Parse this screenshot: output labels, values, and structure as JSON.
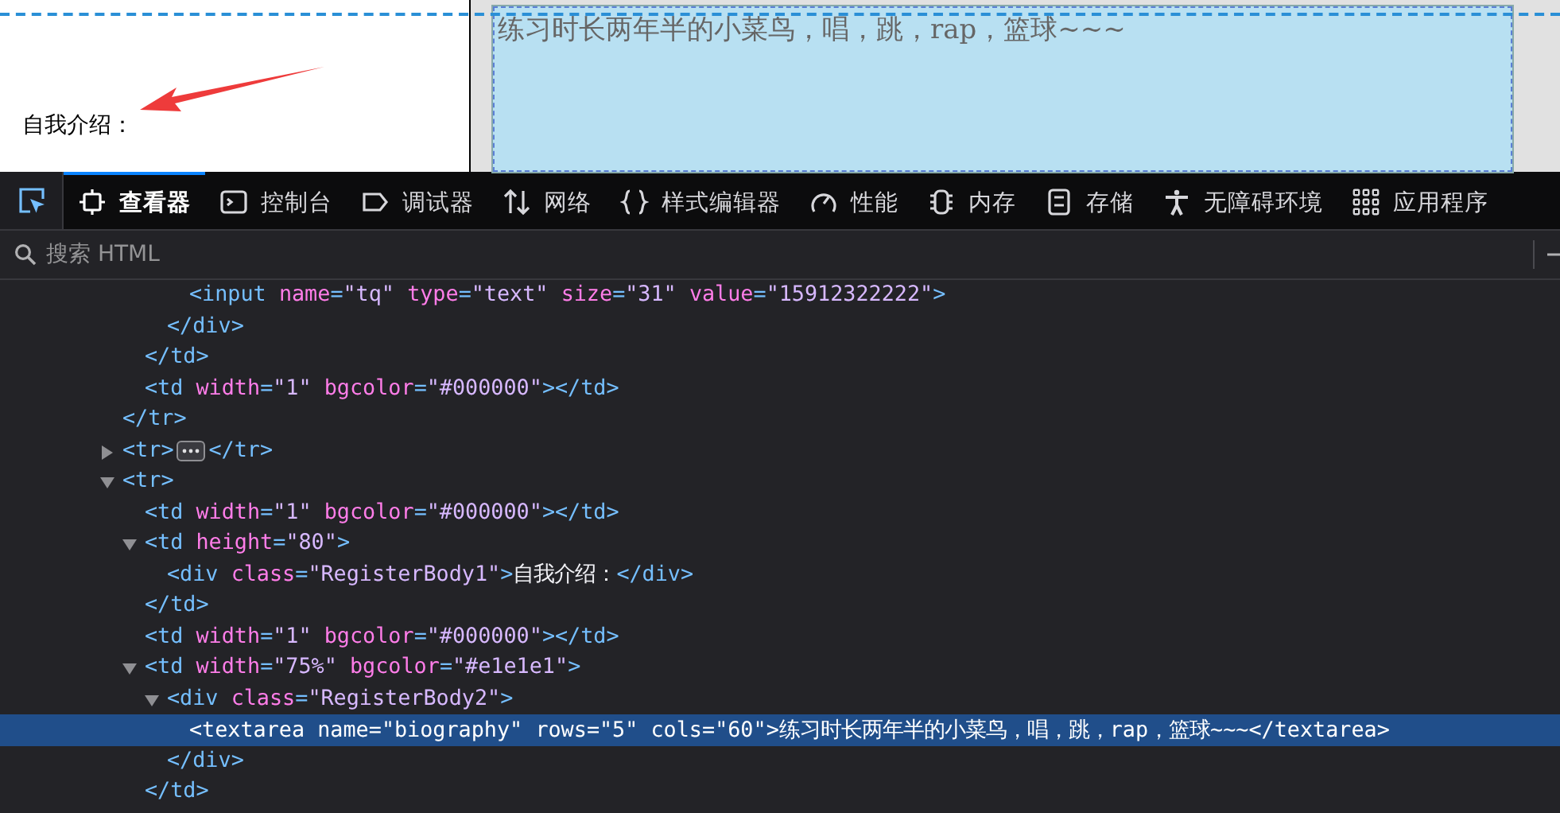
{
  "page": {
    "label": "自我介绍：",
    "textarea_value": "练习时长两年半的小菜鸟，唱，跳，rap，篮球~~~"
  },
  "devtools": {
    "picker_selected": true,
    "tabs": [
      {
        "label": "查看器",
        "selected": true
      },
      {
        "label": "控制台",
        "selected": false
      },
      {
        "label": "调试器",
        "selected": false
      },
      {
        "label": "网络",
        "selected": false
      },
      {
        "label": "样式编辑器",
        "selected": false
      },
      {
        "label": "性能",
        "selected": false
      },
      {
        "label": "内存",
        "selected": false
      },
      {
        "label": "存储",
        "selected": false
      },
      {
        "label": "无障碍环境",
        "selected": false
      },
      {
        "label": "应用程序",
        "selected": false
      }
    ],
    "search": {
      "placeholder": "搜索 HTML"
    },
    "tree": [
      {
        "close": "</tr>",
        "children": [
          {
            "close": "</td>",
            "children": [
              {
                "close": "</div>",
                "children": [
                  {
                    "open": "<input name=\"tq\" type=\"text\" size=\"31\" value=\"15912322222\">",
                    "selected": false
                  }
                ]
              }
            ]
          },
          {
            "open": "<td width=\"1\" bgcolor=\"#000000\"></td>",
            "selected": false
          }
        ]
      },
      {
        "open": "<tr>",
        "close": "</tr>",
        "expanded": false,
        "selected": false
      },
      {
        "open": "<tr>",
        "expanded": true,
        "selected": false,
        "children": [
          {
            "open": "<td width=\"1\" bgcolor=\"#000000\"></td>",
            "selected": false
          },
          {
            "open": "<td height=\"80\">",
            "close": "</td>",
            "expanded": true,
            "selected": false,
            "children": [
              {
                "open": "<div class=\"RegisterBody1\">自我介绍：</div>",
                "selected": false
              }
            ]
          },
          {
            "open": "<td width=\"1\" bgcolor=\"#000000\"></td>",
            "selected": false
          },
          {
            "open": "<td width=\"75%\" bgcolor=\"#e1e1e1\">",
            "close": "</td>",
            "expanded": true,
            "selected": false,
            "children": [
              {
                "open": "<div class=\"RegisterBody2\">",
                "close": "</div>",
                "expanded": true,
                "selected": false,
                "children": [
                  {
                    "open": "<textarea name=\"biography\" rows=\"5\" cols=\"60\">练习时长两年半的小菜鸟，唱，跳，rap，篮球~~~</textarea>",
                    "selected": true
                  }
                ]
              }
            ]
          }
        ]
      }
    ]
  }
}
